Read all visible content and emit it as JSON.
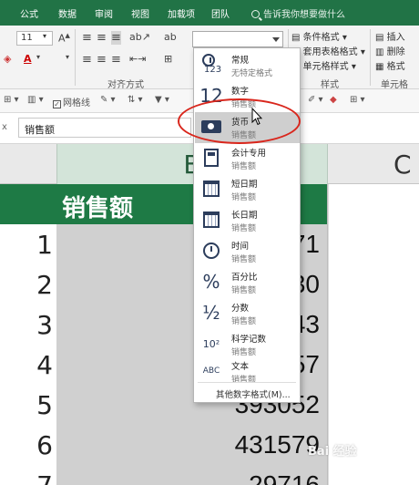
{
  "tabs": [
    "公式",
    "数据",
    "审阅",
    "视图",
    "加载项",
    "团队"
  ],
  "tellme": "告诉我你想要做什么",
  "ribbon": {
    "font_size": "11",
    "group_alignment": "对齐方式",
    "group_styles": "样式",
    "group_cells": "单元格",
    "conditional_format": "条件格式",
    "table_format": "套用表格格式",
    "cell_styles": "单元格样式",
    "insert": "插入",
    "delete": "删除",
    "format": "格式"
  },
  "qat": {
    "gridlines_label": "网格线"
  },
  "formula_bar": {
    "fx_glyph": "x",
    "value": "销售额"
  },
  "columns": {
    "B": "B",
    "C": "C"
  },
  "sheet": {
    "header": "销售额",
    "rows": [
      {
        "num": "1",
        "value": "71"
      },
      {
        "num": "2",
        "value": "30"
      },
      {
        "num": "3",
        "value": "43"
      },
      {
        "num": "4",
        "value": "57"
      },
      {
        "num": "5",
        "value": "393052"
      },
      {
        "num": "6",
        "value": "431579"
      },
      {
        "num": "7",
        "value": "29716"
      }
    ]
  },
  "number_format_dropdown": {
    "items": [
      {
        "name": "常规",
        "sub": "无特定格式",
        "icon": "general-123-icon",
        "glyph": "123"
      },
      {
        "name": "数字",
        "sub": "销售额",
        "icon": "number-12-icon",
        "glyph": "12"
      },
      {
        "name": "货币",
        "sub": "销售额",
        "icon": "currency-icon",
        "glyph": ""
      },
      {
        "name": "会计专用",
        "sub": "销售额",
        "icon": "accounting-icon",
        "glyph": ""
      },
      {
        "name": "短日期",
        "sub": "销售额",
        "icon": "short-date-icon",
        "glyph": ""
      },
      {
        "name": "长日期",
        "sub": "销售额",
        "icon": "long-date-icon",
        "glyph": ""
      },
      {
        "name": "时间",
        "sub": "销售额",
        "icon": "time-clock-icon",
        "glyph": ""
      },
      {
        "name": "百分比",
        "sub": "销售额",
        "icon": "percent-icon",
        "glyph": "%"
      },
      {
        "name": "分数",
        "sub": "销售额",
        "icon": "fraction-icon",
        "glyph": "½"
      },
      {
        "name": "科学记数",
        "sub": "销售额",
        "icon": "scientific-icon",
        "glyph": "10²"
      },
      {
        "name": "文本",
        "sub": "销售额",
        "icon": "text-abc-icon",
        "glyph": "ABC"
      }
    ],
    "more": "其他数字格式(M)..."
  },
  "watermark": "Bai 经验",
  "colors": {
    "accent": "#217346",
    "header_fill": "#1e7a45",
    "highlight": "#d9261c"
  }
}
